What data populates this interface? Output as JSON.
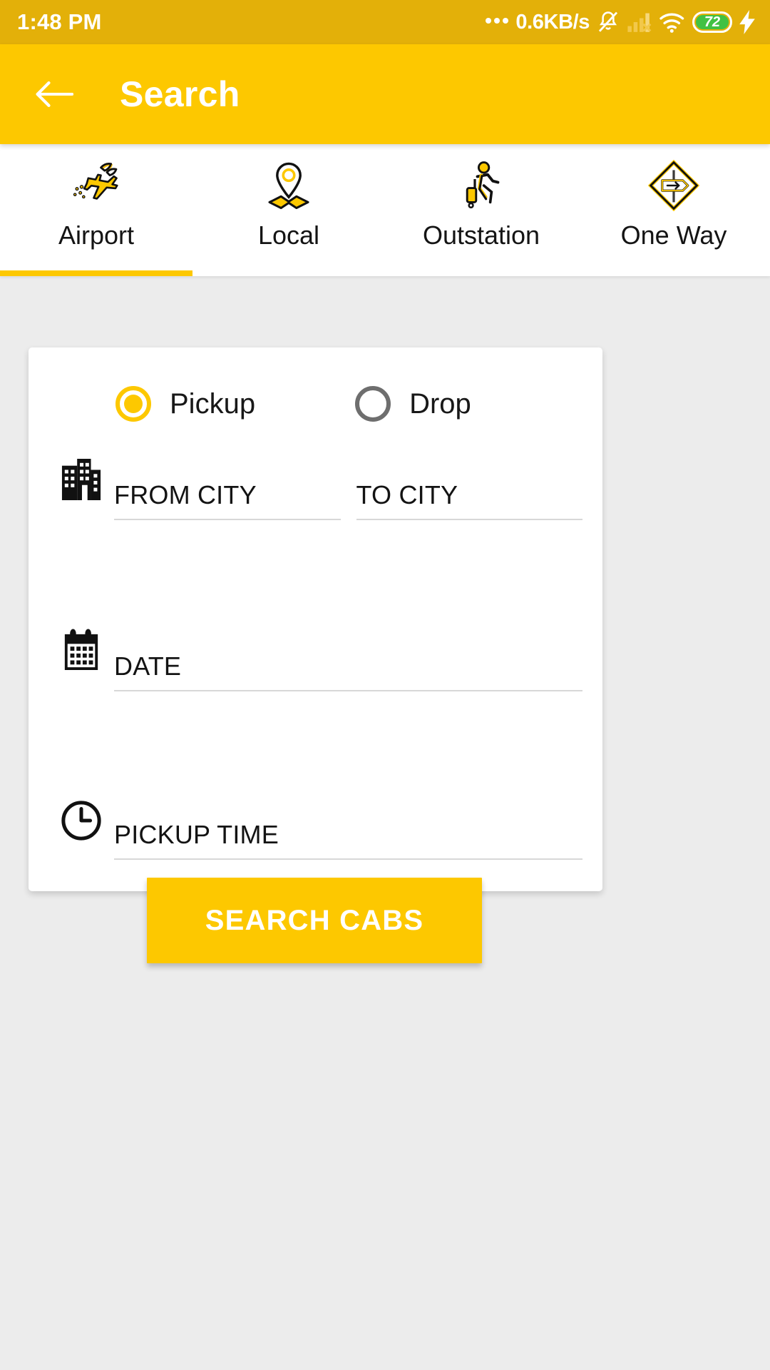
{
  "status_bar": {
    "time": "1:48 PM",
    "network_speed": "0.6KB/s",
    "battery_level": "72",
    "icons": [
      "dots-icon",
      "bell-muted-icon",
      "signal-bars-icon",
      "wifi-icon",
      "battery-icon",
      "charging-bolt-icon"
    ]
  },
  "appbar": {
    "title": "Search",
    "back_icon": "back-arrow-icon"
  },
  "tabs": [
    {
      "label": "Airport",
      "icon": "airplane-icon",
      "active": true
    },
    {
      "label": "Local",
      "icon": "map-pin-icon",
      "active": false
    },
    {
      "label": "Outstation",
      "icon": "traveler-icon",
      "active": false
    },
    {
      "label": "One Way",
      "icon": "road-sign-icon",
      "active": false
    }
  ],
  "form": {
    "trip_type": {
      "options": [
        {
          "label": "Pickup",
          "selected": true
        },
        {
          "label": "Drop",
          "selected": false
        }
      ]
    },
    "city_row": {
      "icon": "buildings-icon",
      "from_placeholder": "FROM CITY",
      "from_value": "",
      "to_placeholder": "TO CITY",
      "to_value": ""
    },
    "date_row": {
      "icon": "calendar-icon",
      "placeholder": "DATE",
      "value": ""
    },
    "time_row": {
      "icon": "clock-icon",
      "placeholder": "PICKUP TIME",
      "value": ""
    }
  },
  "search_button": {
    "label": "SEARCH CABS"
  },
  "colors": {
    "brand_yellow": "#fdc800",
    "status_bar_yellow": "#e3b009",
    "page_background": "#ececec",
    "card_background": "#ffffff",
    "text_primary": "#141414",
    "radio_off": "#6e6e6e",
    "battery_green": "#41c143"
  }
}
